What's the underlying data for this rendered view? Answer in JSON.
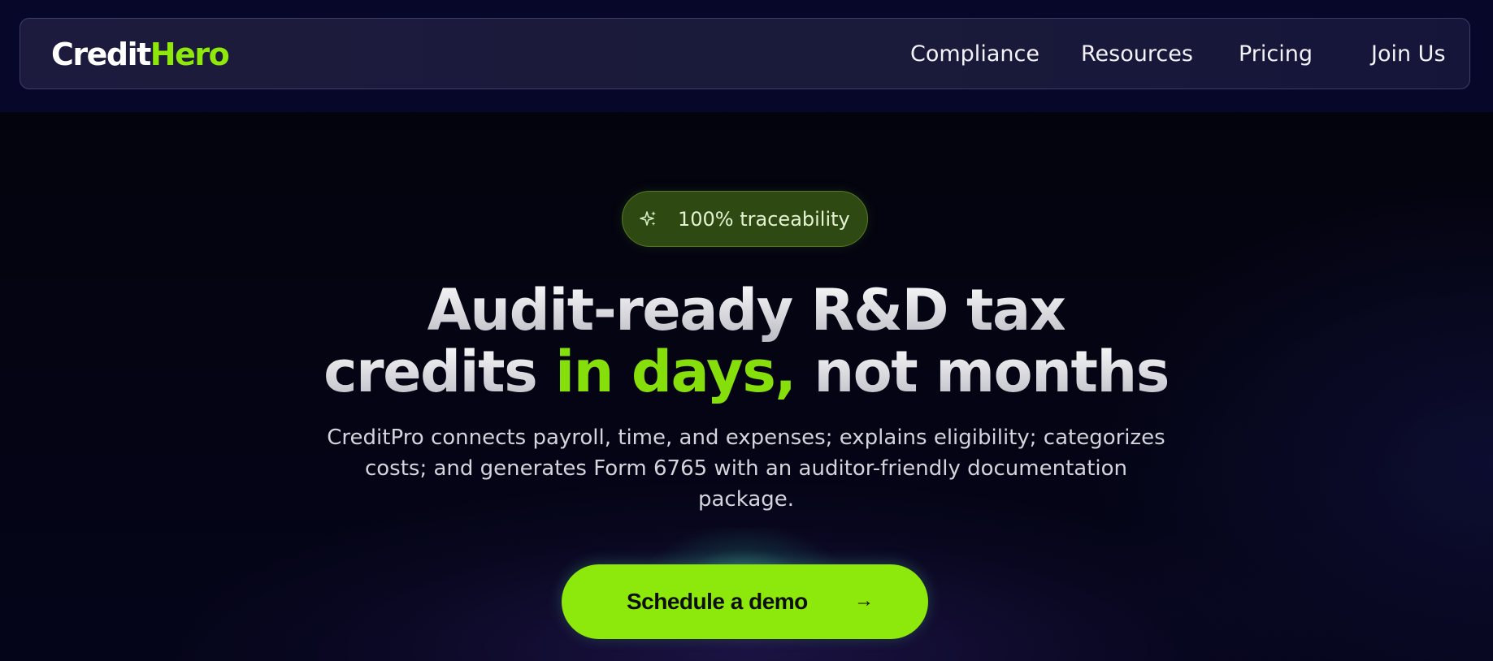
{
  "navbar": {
    "logo_part1": "Credit",
    "logo_part2": "Hero",
    "links": [
      {
        "label": "Compliance"
      },
      {
        "label": "Resources"
      },
      {
        "label": "Pricing"
      },
      {
        "label": "Join Us"
      }
    ]
  },
  "hero": {
    "badge": {
      "icon": "sparkle-icon",
      "label": "100% traceability"
    },
    "headline": {
      "line1": "Audit-ready R&D tax",
      "line2_a": "credits",
      "line2_accent": "in days,",
      "line2_b": "not months"
    },
    "subtext": "CreditPro connects payroll, time, and expenses; explains eligibility; categorizes costs; and generates Form 6765 with an auditor-friendly documentation package.",
    "cta": {
      "label": "Schedule a demo",
      "icon": "arrow-right-icon",
      "arrow": "→"
    }
  },
  "colors": {
    "accent": "#8de80b",
    "background": "#05050f",
    "navbar": "#1c1b3d",
    "badge": "#2e4a12"
  }
}
